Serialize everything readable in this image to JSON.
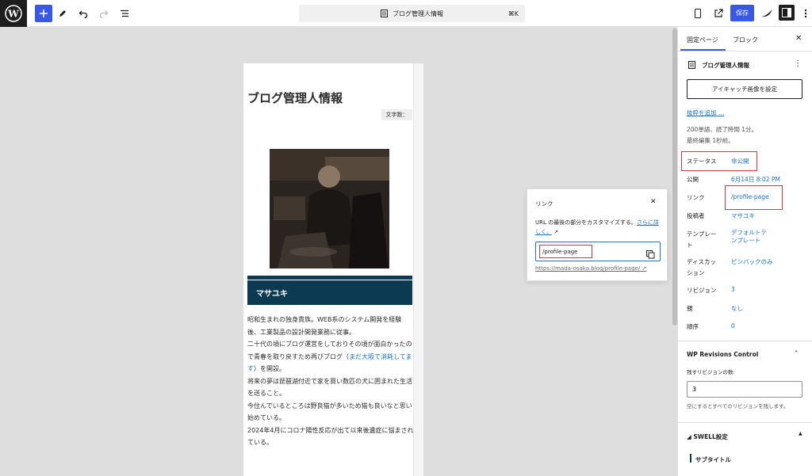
{
  "toolbar": {
    "doc_title": "ブログ管理人情報",
    "shortcut": "⌘K",
    "save_label": "保存"
  },
  "editor": {
    "page_title": "ブログ管理人情報",
    "char_count_label": "文字数：",
    "heading": "マサユキ",
    "bio": {
      "p1": "昭和生まれの独身貴族。WEB系のシステム開発を経験後、工業製品の設計開発業務に従事。",
      "p2a": "二十代の頃にブログ運営をしておりその頃が面白かったので青春を取り戻すため再びブログ（",
      "p2link": "まだ大阪で消耗してます",
      "p2b": "）を開設。",
      "p3": "将来の夢は琵琶湖付近で家を買い数匹の犬に囲まれた生活を送ること。",
      "p4": "今住んでいるところは野良猫が多いため猫も良いなと思い始めている。",
      "p5": "2024年4月にコロナ陽性反応が出て以来後遺症に悩まされている。"
    }
  },
  "link_popover": {
    "title": "リンク",
    "desc": "URL の最後の部分をカスタマイズする。",
    "more": "さらに詳しく。",
    "slug_value": "/profile-page",
    "full_url": "https://mada-osaka.blog/profile-page/"
  },
  "sidebar": {
    "tab_page": "固定ページ",
    "tab_block": "ブロック",
    "doc_title": "ブログ管理人情報",
    "featured_image_btn": "アイキャッチ画像を設定",
    "add_excerpt": "抜粋を追加 …",
    "meta_line1": "200単語、読了時間 1分。",
    "meta_line2": "最終編集 1秒前。",
    "status_label": "ステータス",
    "status_value": "非公開",
    "publish_label": "公開",
    "publish_value": "6月14日 8:02 PM",
    "link_label": "リンク",
    "link_value": "/profile-page",
    "author_label": "投稿者",
    "author_value": "マサユキ",
    "template_label_1": "テンプレー",
    "template_label_2": "ト",
    "template_value_1": "デフォルトテ",
    "template_value_2": "ンプレート",
    "discussion_label_1": "ディスカッ",
    "discussion_label_2": "ション",
    "discussion_value": "ピンバックのみ",
    "revisions_label": "リビジョン",
    "revisions_value": "3",
    "parent_label": "親",
    "parent_value": "なし",
    "order_label": "順序",
    "order_value": "0",
    "wp_revisions_title": "WP Revisions Control",
    "rev_keep_label": "残すリビジョンの数:",
    "rev_keep_value": "3",
    "rev_help": "空にするとすべてのリビジョンを残します。",
    "swell_title": "SWELL設定",
    "subtitle_label": "サブタイトル"
  }
}
